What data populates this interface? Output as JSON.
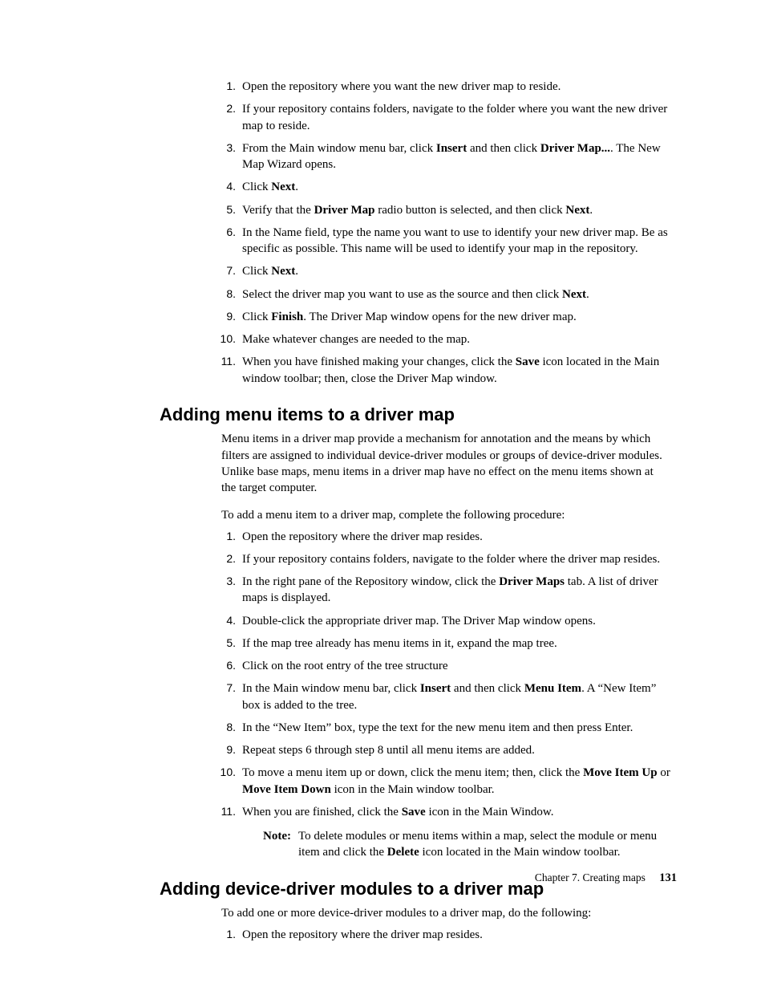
{
  "list1": {
    "i1": "Open the repository where you want the new driver map to reside.",
    "i2": "If your repository contains folders, navigate to the folder where you want the new driver map to reside.",
    "i3a": "From the Main window menu bar, click ",
    "i3b": "Insert",
    "i3c": " and then click ",
    "i3d": "Driver Map...",
    "i3e": ". The New Map Wizard opens.",
    "i4a": "Click ",
    "i4b": "Next",
    "i4c": ".",
    "i5a": "Verify that the ",
    "i5b": "Driver Map",
    "i5c": " radio button is selected, and then click ",
    "i5d": "Next",
    "i5e": ".",
    "i6": "In the Name field, type the name you want to use to identify your new driver map. Be as specific as possible. This name will be used to identify your map in the repository.",
    "i7a": "Click ",
    "i7b": "Next",
    "i7c": ".",
    "i8a": "Select the driver map you want to use as the source and then click ",
    "i8b": "Next",
    "i8c": ".",
    "i9a": "Click ",
    "i9b": "Finish",
    "i9c": ". The Driver Map window opens for the new driver map.",
    "i10": "Make whatever changes are needed to the map.",
    "i11a": "When you have finished making your changes, click the ",
    "i11b": "Save",
    "i11c": " icon located in the Main window toolbar; then, close the Driver Map window."
  },
  "heading2": "Adding menu items to a driver map",
  "para2a": "Menu items in a driver map provide a mechanism for annotation and the means by which filters are assigned to individual device-driver modules or groups of device-driver modules. Unlike base maps, menu items in a driver map have no effect on the menu items shown at the target computer.",
  "para2b": "To add a menu item to a driver map, complete the following procedure:",
  "list2": {
    "i1": "Open the repository where the driver map resides.",
    "i2": "If your repository contains folders, navigate to the folder where the driver map resides.",
    "i3a": "In the right pane of the Repository window, click the ",
    "i3b": "Driver Maps",
    "i3c": " tab. A list of driver maps is displayed.",
    "i4": "Double-click the appropriate driver map. The Driver Map window opens.",
    "i5": "If the map tree already has menu items in it, expand the map tree.",
    "i6": "Click on the root entry of the tree structure",
    "i7a": "In the Main window menu bar, click ",
    "i7b": "Insert",
    "i7c": " and then click ",
    "i7d": "Menu Item",
    "i7e": ". A “New Item” box is added to the tree.",
    "i8": "In the “New Item” box, type the text for the new menu item and then press Enter.",
    "i9": "Repeat steps 6 through step 8 until all menu items are added.",
    "i10a": "To move a menu item up or down, click the menu item; then, click the ",
    "i10b": "Move Item Up",
    "i10c": " or ",
    "i10d": "Move Item Down",
    "i10e": " icon in the Main window toolbar.",
    "i11a": "When you are finished, click the ",
    "i11b": "Save",
    "i11c": " icon in the Main Window.",
    "noteLabel": "Note:",
    "noteA": "To delete modules or menu items within a map, select the module or menu item and click the ",
    "noteB": "Delete",
    "noteC": " icon located in the Main window toolbar."
  },
  "heading3": "Adding device-driver modules to a driver map",
  "para3": "To add one or more device-driver modules to a driver map, do the following:",
  "list3": {
    "i1": "Open the repository where the driver map resides."
  },
  "footer": {
    "chapter": "Chapter 7. Creating maps",
    "page": "131"
  }
}
